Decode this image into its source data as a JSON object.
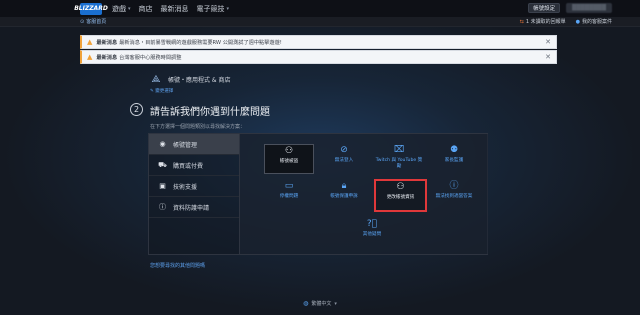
{
  "topnav": {
    "logo": "BLIZZARD",
    "items": [
      {
        "label": "遊戲",
        "has_menu": true
      },
      {
        "label": "商店",
        "has_menu": false
      },
      {
        "label": "最新消息",
        "has_menu": false
      },
      {
        "label": "電子競技",
        "has_menu": true
      }
    ],
    "account_button": "帳號設定",
    "user_name": "████████"
  },
  "subbar": {
    "home_link": "客服首頁",
    "tickets_link": "1 未讀取的回報單",
    "my_tickets": "我的客服案件"
  },
  "alerts": [
    {
      "prefix": "最新消息",
      "text": "最新消息・目前暴雪戰網的遊戲服務需要RW 公開測試了週中點擊遊遊!"
    },
    {
      "prefix": "最新消息",
      "text": "台灣客服中心服務時間調整"
    }
  ],
  "breadcrumb": {
    "title": "帳號・應用程式 & 商店",
    "edit_link": "變更選擇"
  },
  "step": {
    "number": "2",
    "title": "請告訴我們你遇到什麼問題",
    "subtitle": "在下方選擇一個問題類別以尋找解決方案："
  },
  "categories": [
    {
      "label": "帳號管理",
      "icon": "user-circle-icon",
      "active": true
    },
    {
      "label": "購買或付費",
      "icon": "cart-icon",
      "active": false
    },
    {
      "label": "技術支援",
      "icon": "monitor-icon",
      "active": false
    },
    {
      "label": "資料防護申請",
      "icon": "info-icon",
      "active": false
    }
  ],
  "tiles": [
    {
      "label": "帳號被盜",
      "icon": "hacked-icon",
      "state": "selected"
    },
    {
      "label": "無法登入",
      "icon": "login-icon",
      "state": "normal"
    },
    {
      "label": "Twitch 與 YouTube 獎勵",
      "icon": "gift-icon",
      "state": "normal"
    },
    {
      "label": "家長監護",
      "icon": "family-icon",
      "state": "normal"
    },
    {
      "label": "停權問題",
      "icon": "suspension-icon",
      "state": "normal"
    },
    {
      "label": "帳號保護申訴",
      "icon": "lock-icon",
      "state": "normal"
    },
    {
      "label": "更改帳號資訊",
      "icon": "edit-account-icon",
      "state": "highlighted"
    },
    {
      "label": "無法找到適當答案",
      "icon": "info-icon",
      "state": "normal"
    },
    {
      "label": "其他疑問",
      "icon": "question-icon",
      "state": "normal"
    }
  ],
  "help_link": "您想要尋找的其他問題嗎",
  "footer": {
    "language": "繁體中文"
  },
  "colors": {
    "accent": "#5aa5f5",
    "highlight": "#e0383a",
    "warning": "#f0a23a"
  }
}
